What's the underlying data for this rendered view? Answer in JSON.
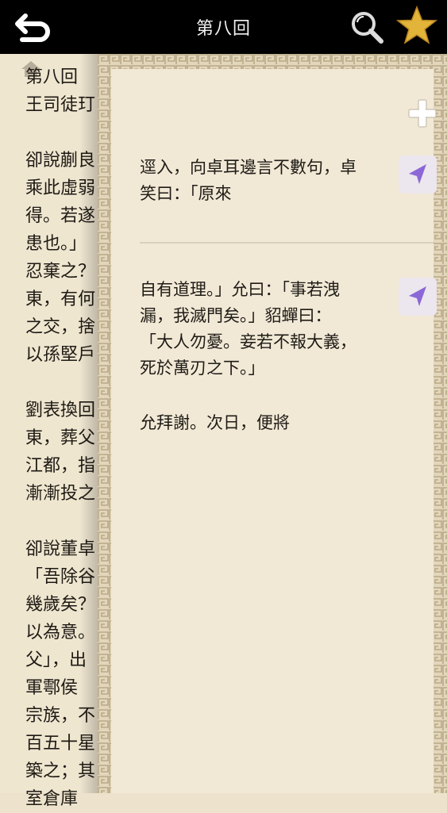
{
  "header": {
    "title": "第八回",
    "back_icon": "back-arrow-icon",
    "search_icon": "search-icon",
    "favorite_icon": "star-icon",
    "star_color": "#e3b43a"
  },
  "reader": {
    "lines": [
      "第八回",
      "王司徒玎",
      "",
      "卻說蒯良",
      "乘此虛弱",
      "得。若遂",
      "患也。」",
      "忍棄之？",
      "東，有何",
      "之交，捨",
      "以孫堅戶",
      "",
      "劉表換回",
      "東，葬父",
      "江都，指",
      "漸漸投之",
      "",
      "卻說董卓",
      "「吾除谷",
      "幾歲矣？",
      "以為意。",
      "父」，出",
      "軍鄠侯",
      "宗族，不",
      "百五十星",
      "築之；其",
      "室倉庫"
    ]
  },
  "panel": {
    "add_icon": "plus-icon",
    "notes": [
      {
        "lines": [
          "逕入，向卓耳邊言不數句，卓",
          "笑曰：「原來"
        ],
        "nav_icon": "navigate-arrow-icon"
      },
      {
        "lines": [
          "自有道理。」允曰：「事若洩",
          "漏，我滅門矣。」貂蟬曰：",
          "「大人勿憂。妾若不報大義，",
          "死於萬刃之下。」"
        ],
        "nav_icon": "navigate-arrow-icon"
      },
      {
        "lines": [
          "允拜謝。次日，便將"
        ]
      }
    ],
    "nav_arrow_color": "#8b67d8"
  }
}
